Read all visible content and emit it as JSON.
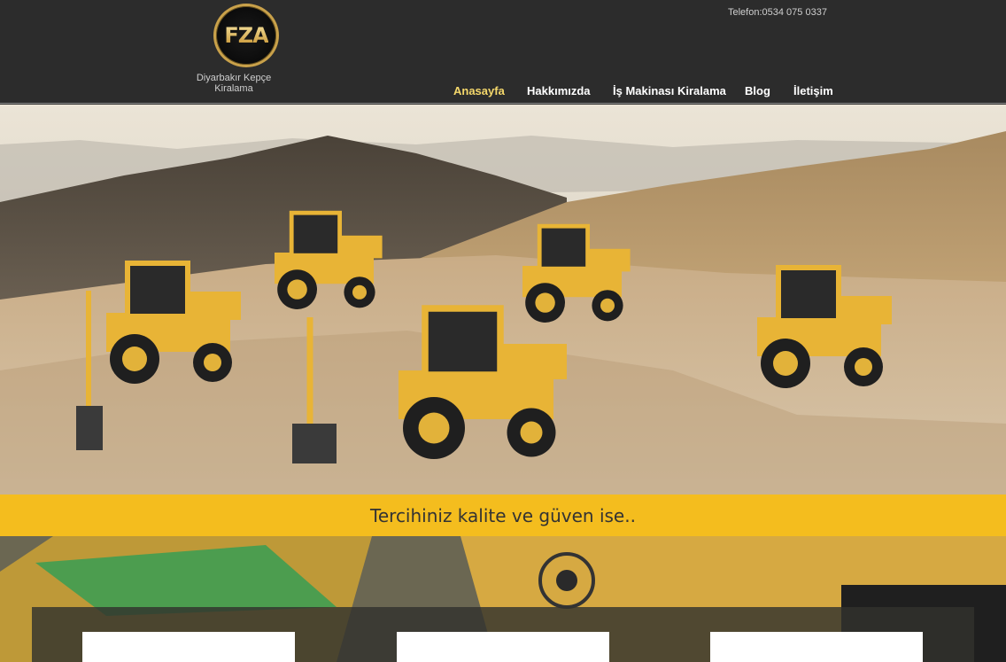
{
  "header": {
    "logo_text": "FZA",
    "tagline": "Diyarbakır Kepçe Kiralama",
    "phone": "Telefon:0534 075 0337"
  },
  "nav": {
    "items": [
      {
        "label": "Anasayfa",
        "active": true
      },
      {
        "label": "Hakkımızda",
        "active": false
      },
      {
        "label": "İş Makinası Kiralama",
        "active": false
      },
      {
        "label": "Blog",
        "active": false
      },
      {
        "label": "İletişim",
        "active": false
      }
    ]
  },
  "hero": {
    "image": "backhoe-loaders-on-mountain-site"
  },
  "band": {
    "text": "Tercihiniz kalite ve güven ise.."
  },
  "colors": {
    "header_bg": "#2c2c2c",
    "accent_yellow": "#f4bd1e",
    "active_nav": "#f5d86b"
  }
}
